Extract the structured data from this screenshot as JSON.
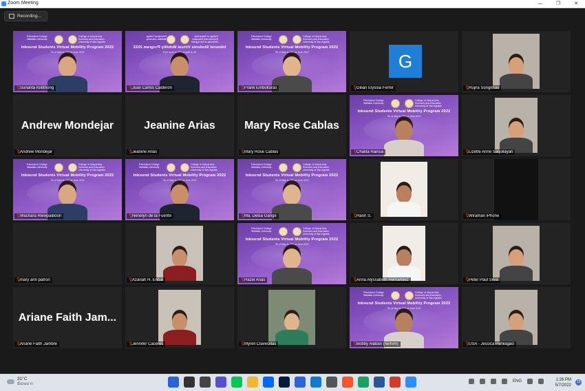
{
  "window": {
    "title": "Zoom Meeting"
  },
  "recording": {
    "label": "Recording..."
  },
  "banner": {
    "college_left": "Petchaburi College\nWalailak University",
    "college_right": "College of Liberal Arts, Sciences and Education\nUniversity of San Agustin",
    "program": "Inbound Students Virtual Mobility Program 2022",
    "dates": "7th of May to 18th of June 2022"
  },
  "participants": [
    {
      "name": "Sunanta Klibthong",
      "type": "banner"
    },
    {
      "name": "Juan Carlos Calderon",
      "type": "banner-mirror",
      "active": true
    },
    {
      "name": "Frank Embolturas",
      "type": "banner"
    },
    {
      "name": "Gilian Elyssia Ferrer",
      "type": "avatar",
      "initial": "G"
    },
    {
      "name": "Rujira Songkhao",
      "type": "photo"
    },
    {
      "name": "Andrew Mondejar",
      "type": "name"
    },
    {
      "name": "Jeanine Arias",
      "type": "name"
    },
    {
      "name": "Mary Rose Cablas",
      "type": "name"
    },
    {
      "name": "Chalita Rainua",
      "type": "banner"
    },
    {
      "name": "Lizette Anne Saquilayan",
      "type": "photo"
    },
    {
      "name": "Wachara Riewpaiboon",
      "type": "banner"
    },
    {
      "name": "Nenelyn de la Fuente",
      "type": "banner"
    },
    {
      "name": "Ma. Delsa Gange",
      "type": "banner"
    },
    {
      "name": "Harin S.",
      "type": "photo"
    },
    {
      "name": "Wiraman iPhone",
      "type": "dark"
    },
    {
      "name": "mary ann patron",
      "type": "blank"
    },
    {
      "name": "Azariah H. Enbal",
      "type": "photo"
    },
    {
      "name": "Hazel Arias",
      "type": "banner"
    },
    {
      "name": "Anna Alyssabeth Hernandez",
      "type": "photo"
    },
    {
      "name": "Peter Paul Silva",
      "type": "photo"
    },
    {
      "name": "Ariane Faith Jambre",
      "type": "name",
      "display": "Ariane Faith Jam..."
    },
    {
      "name": "Jennifer Caceres",
      "type": "photo"
    },
    {
      "name": "Myrell Clavecillas",
      "type": "photo"
    },
    {
      "name": "Bobby Alaban (he/him)",
      "type": "banner"
    },
    {
      "name": "USA - Jessica Pahilagao",
      "type": "photo"
    }
  ],
  "taskbar": {
    "temp": "31°C",
    "weather": "มีเมฆมาก",
    "lang": "ENG",
    "time": "1:26 PM",
    "date": "5/7/2022",
    "notifications": "13",
    "apps": [
      "start-icon",
      "search-icon",
      "taskview-icon",
      "chat-icon",
      "line-icon",
      "explorer-icon",
      "zalo-icon",
      "photoshop-icon",
      "en-icon",
      "edge-icon",
      "store-icon",
      "brave-icon",
      "chrome-icon",
      "word-icon",
      "pdf-icon",
      "zoom-icon"
    ]
  },
  "colors": {
    "accent": "#2D8CFF",
    "active_border": "#d8e86b",
    "banner": "#8a56c4"
  }
}
